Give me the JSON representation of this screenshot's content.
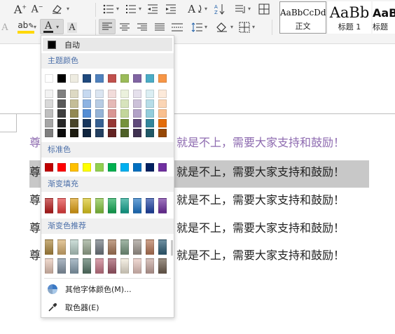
{
  "ribbon": {
    "row1_icons": [
      "font-grow-icon",
      "font-shrink-icon",
      "clear-format-icon",
      "bullet-list-icon",
      "numbered-list-icon",
      "decrease-indent-icon",
      "increase-indent-icon",
      "text-direction-icon",
      "sort-icon",
      "show-marks-icon",
      "table-icon"
    ],
    "row2_icons": [
      "highlight-icon",
      "font-color-icon",
      "char-shading-icon",
      "align-left-icon",
      "align-center-icon",
      "align-right-icon",
      "justify-icon",
      "distributed-icon",
      "line-spacing-icon",
      "shading-icon",
      "borders-icon"
    ],
    "glyphs": {
      "font_grow": "A",
      "font_shrink": "A",
      "font_color": "A",
      "char_shading": "A",
      "highlight": "ab",
      "text_dir": "A"
    },
    "styles": [
      {
        "sample": "AaBbCcDd",
        "name": "正文",
        "active": true
      },
      {
        "sample": "AaBb",
        "name": "标题 1",
        "active": false
      },
      {
        "sample": "AaB",
        "name": "标题",
        "active": false
      }
    ]
  },
  "document": {
    "lines": [
      {
        "visible_start": "尊",
        "visible_end": "就是不上，需要大家支持和鼓励！",
        "color": "#8e6bb0"
      },
      {
        "visible_start": "尊",
        "visible_end": "就是不上，需要大家支持和鼓励！",
        "color": "#222222"
      },
      {
        "visible_start": "尊",
        "visible_end": "就是不上，需要大家支持和鼓励！",
        "color": "#222222"
      },
      {
        "visible_start": "尊",
        "visible_end": "就是不上，需要大家支持和鼓励！",
        "color": "#222222"
      },
      {
        "visible_start": "尊",
        "visible_end": "就是不上，需要大家支持和鼓励！",
        "color": "#222222"
      }
    ]
  },
  "color_menu": {
    "auto_label": "自动",
    "theme_title": "主题颜色",
    "standard_title": "标准色",
    "gradient_fill_title": "渐变填充",
    "gradient_recommend_title": "渐变色推荐",
    "more_colors_label": "其他字体颜色(M)...",
    "eyedropper_label": "取色器(E)",
    "theme_base": [
      "#ffffff",
      "#000000",
      "#eeece1",
      "#1f497d",
      "#4f81bd",
      "#c0504d",
      "#9bbb59",
      "#8064a2",
      "#4bacc6",
      "#f79646"
    ],
    "theme_tints": [
      [
        "#f2f2f2",
        "#7f7f7f",
        "#ddd9c3",
        "#c6d9f0",
        "#dbe5f1",
        "#f2dcdb",
        "#ebf1dd",
        "#e5e0ec",
        "#dbeef3",
        "#fdeada"
      ],
      [
        "#d8d8d8",
        "#595959",
        "#c4bd97",
        "#8db3e2",
        "#b8cce4",
        "#e5b9b7",
        "#d7e3bc",
        "#ccc1d9",
        "#b7dde8",
        "#fbd5b5"
      ],
      [
        "#bfbfbf",
        "#3f3f3f",
        "#938953",
        "#548dd4",
        "#95b3d7",
        "#d99694",
        "#c3d69b",
        "#b2a2c7",
        "#92cddc",
        "#fac08f"
      ],
      [
        "#a5a5a5",
        "#262626",
        "#494429",
        "#17365d",
        "#366092",
        "#953734",
        "#76923c",
        "#5f497a",
        "#31859b",
        "#e36c09"
      ],
      [
        "#7f7f7f",
        "#0c0c0c",
        "#1d1b10",
        "#0f243e",
        "#244061",
        "#632423",
        "#4f6128",
        "#3f3151",
        "#205867",
        "#974806"
      ]
    ],
    "standard": [
      "#c00000",
      "#ff0000",
      "#ffc000",
      "#ffff00",
      "#92d050",
      "#00b050",
      "#00b0f0",
      "#0070c0",
      "#002060",
      "#7030a0"
    ],
    "gradient_fill": [
      "#b41818",
      "#e03a3a",
      "#d99a10",
      "#d8c21a",
      "#7fbf3a",
      "#10a550",
      "#10a08a",
      "#1a6fc0",
      "#1a3fa0",
      "#6a2a9a"
    ],
    "gradient_recommend": [
      [
        "#b08a40",
        "#d8b070",
        "#b8d0c8",
        "#98a890",
        "#707880",
        "#a87858",
        "#789880",
        "#a09890",
        "#b87858",
        "#306078"
      ],
      [
        "#e8c8b8",
        "#8898a8",
        "#88a0b0",
        "#587868",
        "#c87888",
        "#a05868",
        "#f0e8d8",
        "#e8c8c0",
        "#c8a8a0",
        "#706050"
      ]
    ]
  }
}
